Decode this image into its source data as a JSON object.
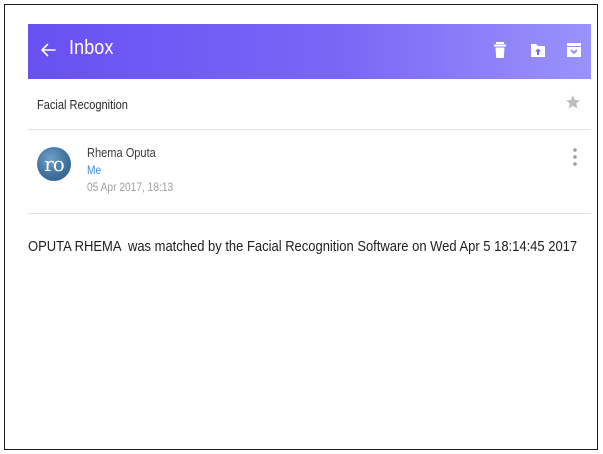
{
  "header": {
    "title": "Inbox",
    "background_gradient": [
      "#6950f2",
      "#9a93fb"
    ],
    "actions": [
      {
        "name": "delete",
        "icon": "trash-icon"
      },
      {
        "name": "move-to-folder",
        "icon": "folder-upload-icon"
      },
      {
        "name": "archive",
        "icon": "archive-icon"
      }
    ]
  },
  "message": {
    "subject": "Facial Recognition",
    "starred": false,
    "sender": {
      "name": "Rhema Oputa",
      "avatar_initials": "ro",
      "avatar_color": "#3d6e9c"
    },
    "recipient": "Me",
    "recipient_color": "#3b8fe0",
    "timestamp": "05 Apr 2017, 18:13",
    "body": "OPUTA RHEMA  was matched by the Facial Recognition Software on Wed Apr 5 18:14:45 2017"
  }
}
